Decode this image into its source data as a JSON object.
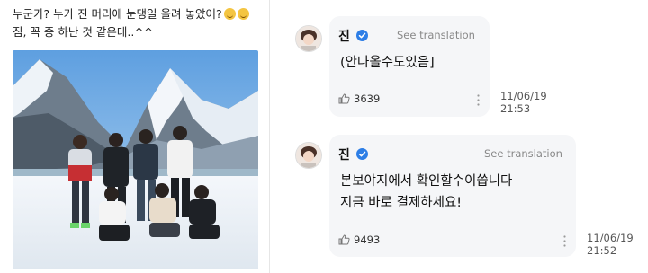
{
  "left_post": {
    "caption_line1": "누군가? 누가 진 머리에 눈댕일 올려 놓았어?",
    "caption_line2": "짐, 꼭 중 하난 것 같은데..^^"
  },
  "comments": [
    {
      "author": "진",
      "see_translation": "See translation",
      "lines": [
        "(안나올수도있음]"
      ],
      "likes": "3639",
      "date": "11/06/19",
      "time": "21:53"
    },
    {
      "author": "진",
      "see_translation": "See translation",
      "lines": [
        "본보야지에서 확인할수이씁니다",
        "지금 바로 결제하세요!"
      ],
      "likes": "9493",
      "date": "11/06/19",
      "time": "21:52"
    }
  ],
  "colors": {
    "verified": "#2d7ee6",
    "bubble": "#f5f6f8",
    "sky": "#7bb4e8"
  },
  "icons": [
    "smile-emoji",
    "verified-badge-icon",
    "like-thumb-icon",
    "more-dots-icon"
  ]
}
